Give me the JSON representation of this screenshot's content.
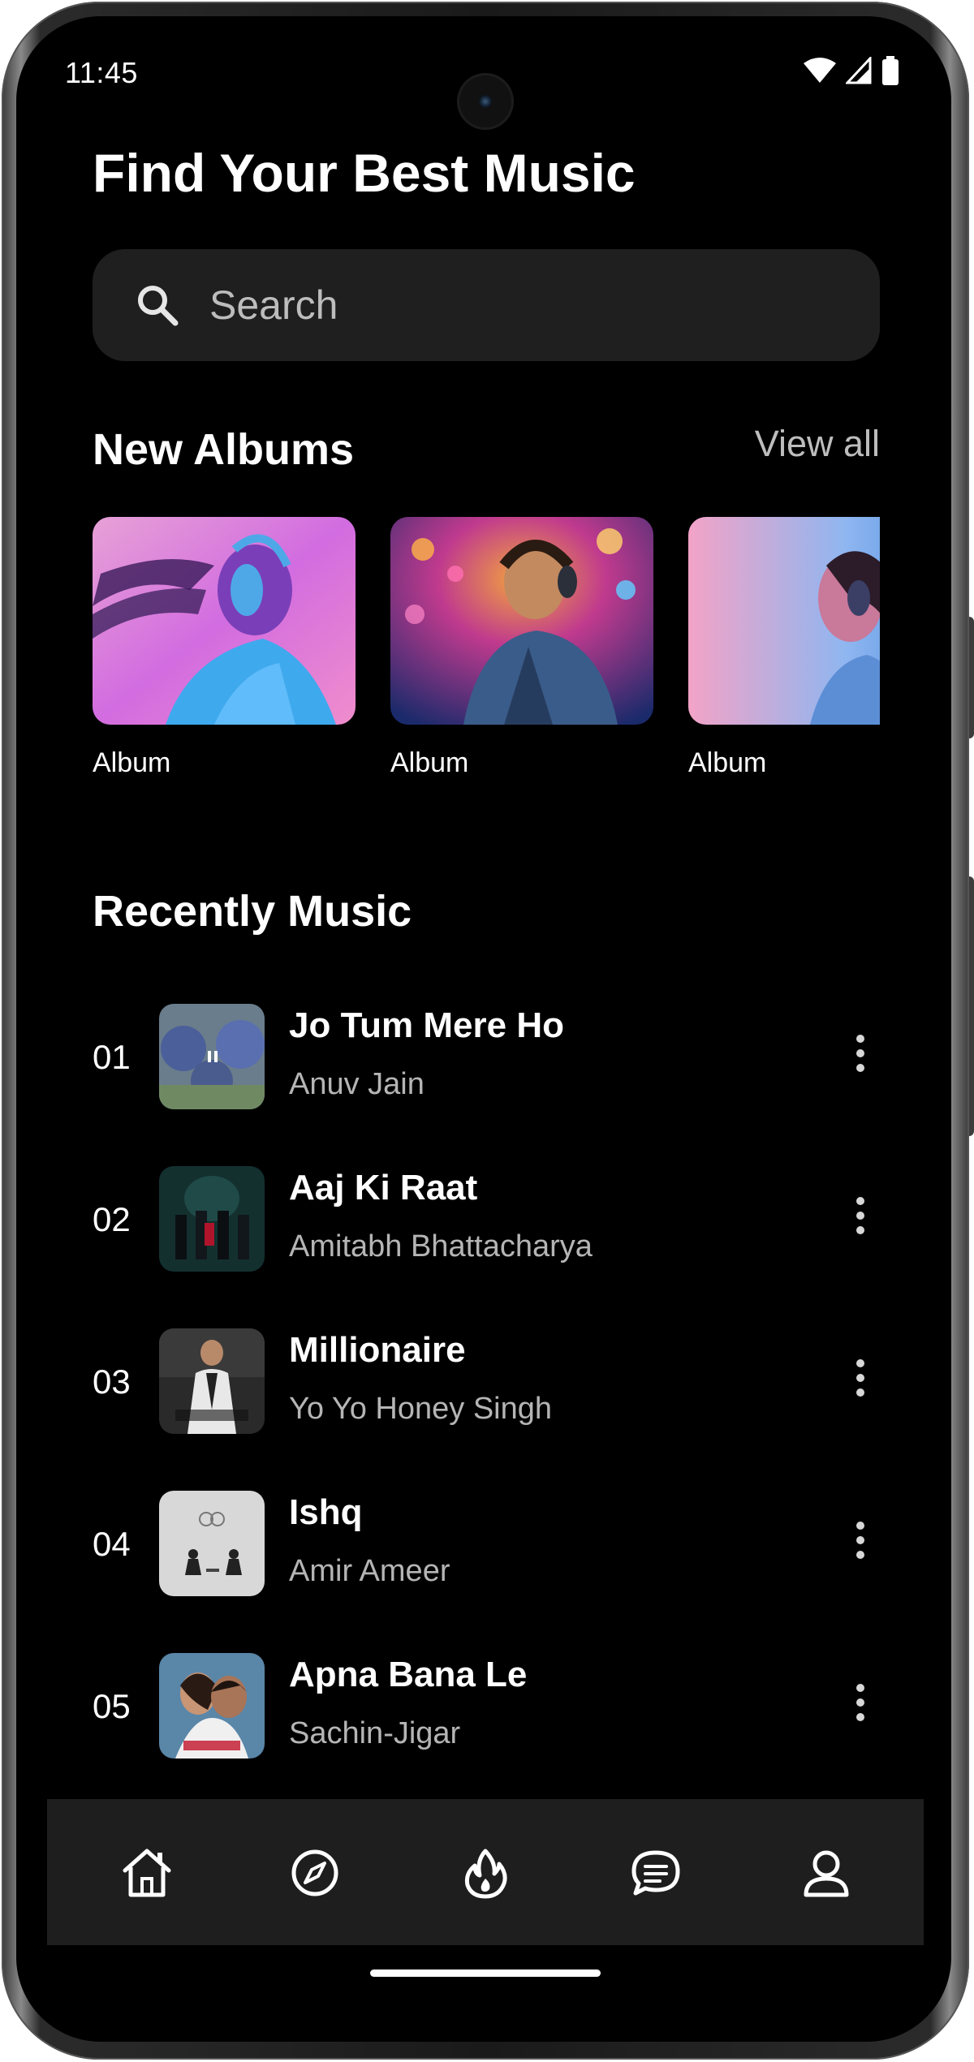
{
  "status_bar": {
    "time": "11:45",
    "icons": [
      "wifi-icon",
      "cell-signal-icon",
      "battery-icon"
    ]
  },
  "header": {
    "title": "Find Your Best Music"
  },
  "search": {
    "placeholder": "Search",
    "icon": "search-icon"
  },
  "albums_section": {
    "title": "New Albums",
    "view_all_label": "View all",
    "items": [
      {
        "label": "Album"
      },
      {
        "label": "Album"
      },
      {
        "label": "Album"
      }
    ]
  },
  "recent_section": {
    "title": "Recently Music",
    "tracks": [
      {
        "number": "01",
        "title": "Jo Tum Mere Ho",
        "artist": "Anuv Jain"
      },
      {
        "number": "02",
        "title": "Aaj Ki Raat",
        "artist": "Amitabh Bhattacharya"
      },
      {
        "number": "03",
        "title": "Millionaire",
        "artist": "Yo Yo Honey Singh"
      },
      {
        "number": "04",
        "title": "Ishq",
        "artist": "Amir Ameer"
      },
      {
        "number": "05",
        "title": "Apna Bana Le",
        "artist": "Sachin-Jigar"
      }
    ]
  },
  "bottom_nav": {
    "items": [
      "home-icon",
      "explore-compass-icon",
      "trending-flame-icon",
      "chat-icon",
      "profile-icon"
    ]
  },
  "colors": {
    "background": "#000000",
    "surface": "#1f1f1f",
    "text_primary": "#ffffff",
    "text_secondary": "#b5b5b5"
  }
}
